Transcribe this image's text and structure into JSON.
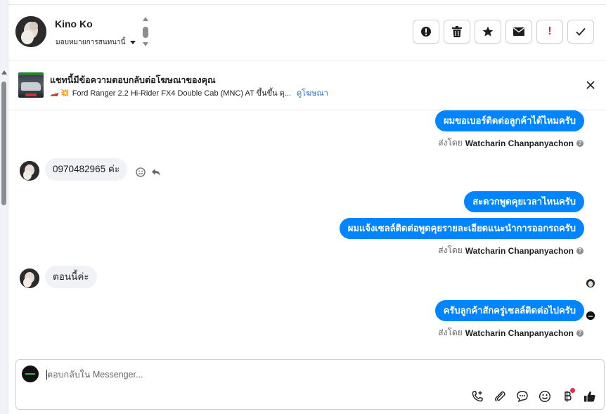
{
  "header": {
    "name": "Kino Ko",
    "assign_label": "มอบหมายการสนทนานี้",
    "actions": [
      {
        "icon": "alert-circle-icon"
      },
      {
        "icon": "trash-icon"
      },
      {
        "icon": "star-icon"
      },
      {
        "icon": "envelope-icon"
      },
      {
        "icon": "exclamation-icon",
        "text": "!"
      },
      {
        "icon": "check-icon"
      }
    ]
  },
  "ad": {
    "title": "แชทนี้มีข้อความตอบกลับต่อโฆษณาของคุณ",
    "subtitle": "Ford Ranger 2.2 Hi-Rider FX4 Double Cab (MNC) AT ขึ้นขึ้น ดุ...",
    "link": "ดูโฆษณา",
    "emojis": "🏎️ 💥"
  },
  "messages": [
    {
      "dir": "out",
      "text": "ผมขอเบอร์ติดต่อลูกค้าได้ไหมครับ"
    },
    {
      "dir": "sent_by",
      "prefix": "ส่งโดย",
      "name": "Watcharin Chanpanyachon"
    },
    {
      "dir": "in",
      "text": "0970482965 ค่ะ"
    },
    {
      "dir": "out",
      "text": "สะดวกพูดคุยเวลาไหนครับ"
    },
    {
      "dir": "out",
      "text": "ผมแจ้งเซลล์ติดต่อพูดคุยรายละเอียดแนะนำการออกรถครับ"
    },
    {
      "dir": "sent_by",
      "prefix": "ส่งโดย",
      "name": "Watcharin Chanpanyachon"
    },
    {
      "dir": "in",
      "text": "ตอนนี้ค่ะ"
    },
    {
      "dir": "out",
      "text": "ครับลูกค้าสักครู่เซลล์ติดต่อไปครับ"
    },
    {
      "dir": "sent_by",
      "prefix": "ส่งโดย",
      "name": "Watcharin Chanpanyachon"
    }
  ],
  "composer": {
    "placeholder": "ตอบกลับใน Messenger...",
    "tools": [
      "call-add-icon",
      "paperclip-icon",
      "saved-reply-icon",
      "emoji-icon",
      "baht-icon",
      "thumbs-up-icon"
    ]
  },
  "colors": {
    "accent": "#0084ff",
    "link": "#216fdb",
    "alert": "#e41e3f"
  }
}
